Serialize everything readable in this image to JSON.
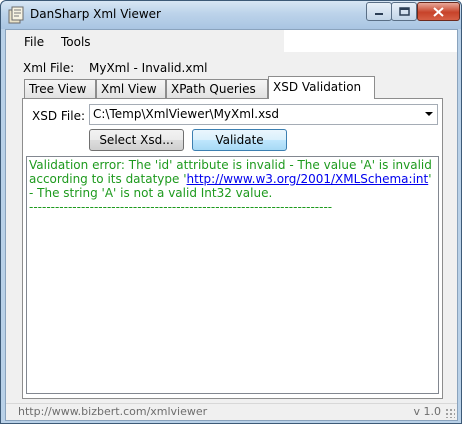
{
  "window": {
    "title": "DanSharp Xml Viewer",
    "icon": "xml-viewer-app-icon"
  },
  "menu": {
    "items": [
      {
        "label": "File"
      },
      {
        "label": "Tools"
      }
    ]
  },
  "xml_file": {
    "label": "Xml File:",
    "value": "MyXml - Invalid.xml"
  },
  "tabs": [
    {
      "label": "Tree View",
      "selected": false
    },
    {
      "label": "Xml View",
      "selected": false
    },
    {
      "label": "XPath Queries",
      "selected": false
    },
    {
      "label": "XSD Validation",
      "selected": true
    }
  ],
  "xsd": {
    "label": "XSD File:",
    "value": "C:\\Temp\\XmlViewer\\MyXml.xsd",
    "select_button": "Select Xsd...",
    "validate_button": "Validate"
  },
  "output": {
    "text_before_link": "Validation error: The 'id' attribute is invalid - The value 'A' is invalid according to its datatype '",
    "link": "http://www.w3.org/2001/XMLSchema:int",
    "text_after_link": "' - The string 'A' is not a valid Int32 value.",
    "separator": "----------------------------------------------------------------------"
  },
  "status": {
    "url": "http://www.bizbert.com/xmlviewer",
    "version": "v 1.0"
  },
  "colors": {
    "output_text": "#1e9a1e",
    "link": "#0000ee",
    "titlebar": "#bcd3ea"
  }
}
